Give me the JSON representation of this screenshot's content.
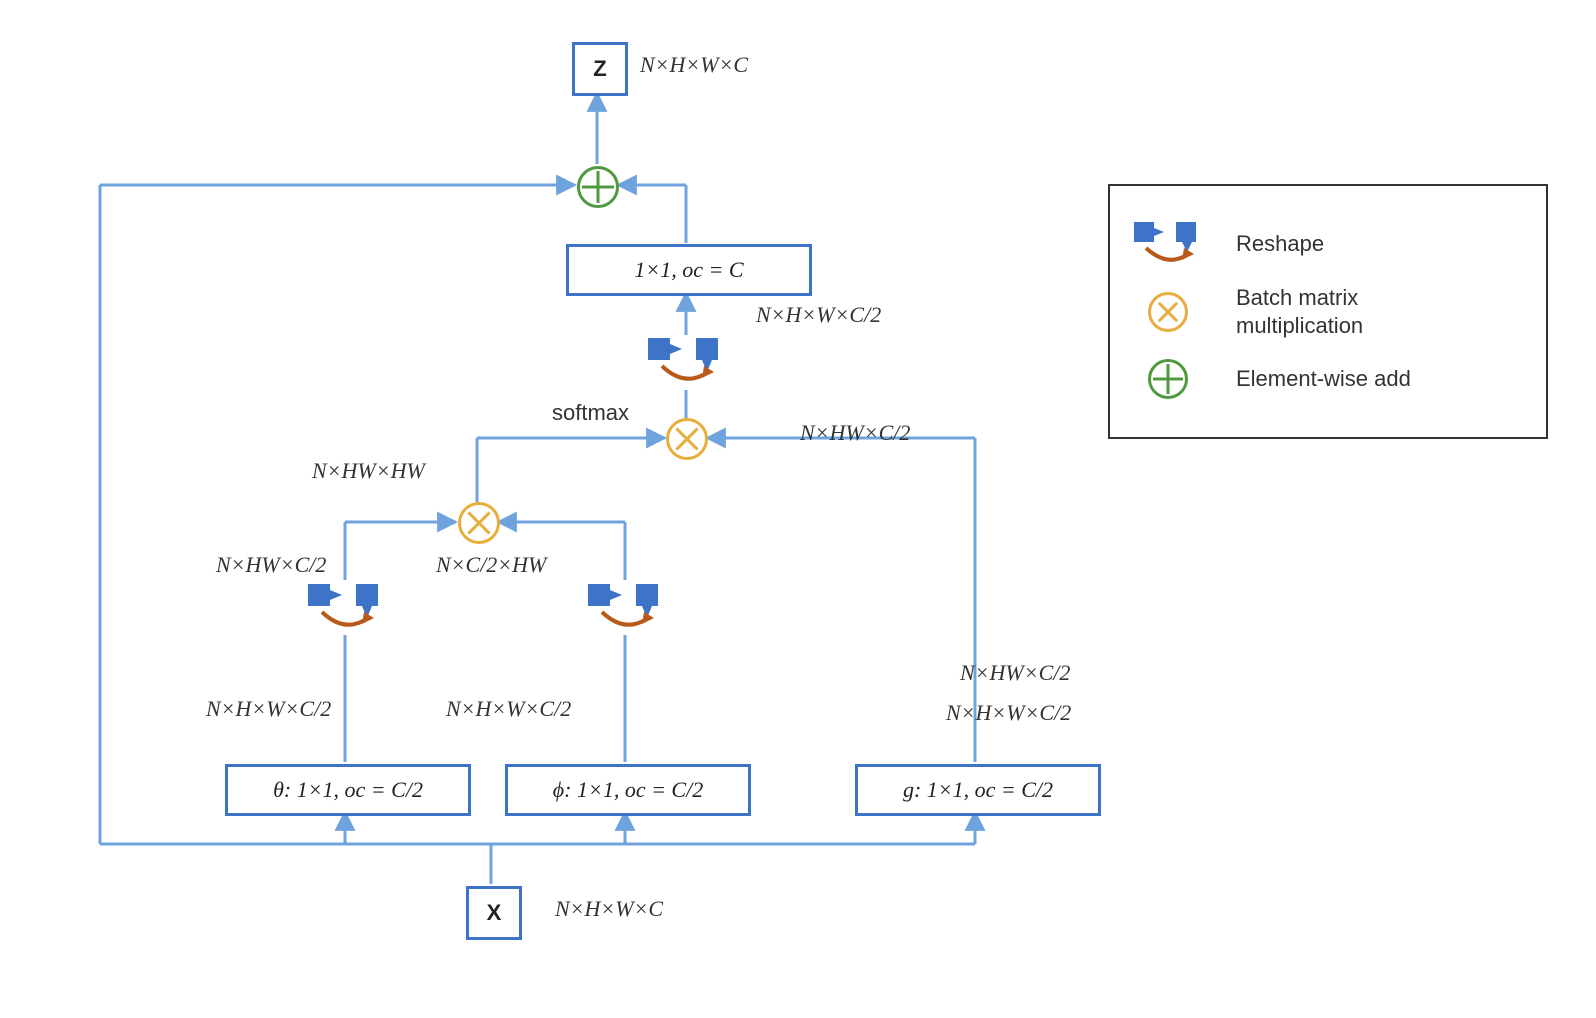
{
  "nodes": {
    "z": {
      "label": "Z",
      "shape": "N×H×W×C"
    },
    "x": {
      "label": "X",
      "shape": "N×H×W×C"
    },
    "conv_out": {
      "label": "1×1, oc = C"
    },
    "theta": {
      "label": "θ: 1×1, oc = C/2"
    },
    "phi": {
      "label": "ϕ: 1×1, oc = C/2"
    },
    "g": {
      "label": "g: 1×1, oc = C/2"
    }
  },
  "shapes": {
    "after_convout": "N×H×W×C/2",
    "after_mul2_reshape_in": "N×HW×C/2",
    "softmax": "softmax",
    "mul1_out": "N×HW×HW",
    "theta_reshape": "N×HW×C/2",
    "phi_reshape": "N×C/2×HW",
    "theta_conv": "N×H×W×C/2",
    "phi_conv": "N×H×W×C/2",
    "g_line1": "N×HW×C/2",
    "g_line2": "N×H×W×C/2"
  },
  "legend": {
    "reshape": "Reshape",
    "matmul": "Batch matrix\nmultiplication",
    "add": "Element-wise add"
  }
}
